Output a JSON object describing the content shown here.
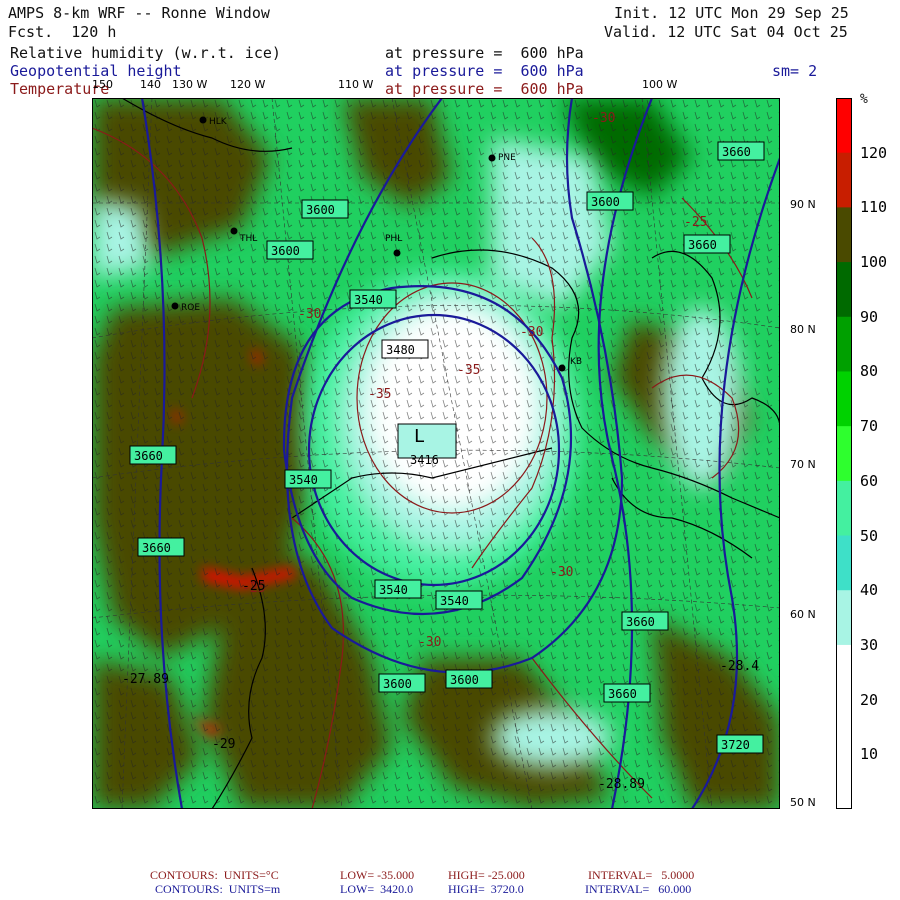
{
  "header": {
    "title": "AMPS 8-km WRF -- Ronne Window",
    "fcst": "Fcst.  120 h",
    "init": "Init. 12 UTC Mon 29 Sep 25",
    "valid": "Valid. 12 UTC Sat 04 Oct 25",
    "sm": "sm= 2"
  },
  "fields": [
    {
      "name": "Relative humidity (w.r.t. ice)",
      "pressure": "at pressure =  600 hPa",
      "color": "#111111"
    },
    {
      "name": "Geopotential height",
      "pressure": "at pressure =  600 hPa",
      "color": "#1a1a99"
    },
    {
      "name": "Temperature",
      "pressure": "at pressure =  600 hPa",
      "color": "#8b1a1a"
    }
  ],
  "longitude_labels": [
    "150",
    "140",
    "130 W",
    "120 W",
    "110 W",
    "100 W"
  ],
  "latitude_labels": [
    "90 N",
    "80 N",
    "70 N",
    "60 N",
    "50 N"
  ],
  "colorbar": {
    "unit": "%",
    "labels": [
      "120",
      "110",
      "100",
      "90",
      "80",
      "70",
      "60",
      "50",
      "40",
      "30",
      "20",
      "10"
    ],
    "colors": [
      "#ff0000",
      "#c81e00",
      "#4a4a00",
      "#006a00",
      "#00a000",
      "#00d200",
      "#2eff2e",
      "#44f0a0",
      "#3ee0c8",
      "#a8f4e4",
      "#ffffff",
      "#ffffff",
      "#ffffff"
    ]
  },
  "stations": [
    {
      "code": "PNE"
    },
    {
      "code": "PHL"
    },
    {
      "code": "THL"
    },
    {
      "code": "ROE"
    },
    {
      "code": "HLK"
    },
    {
      "code": "KB"
    }
  ],
  "height_contour_labels": [
    "3600",
    "3600",
    "3540",
    "3480",
    "3660",
    "3540",
    "3660",
    "3540",
    "3540",
    "3600",
    "3600",
    "3660",
    "3660",
    "3660",
    "3660",
    "3720",
    "3600"
  ],
  "temperature_labels": [
    "-30",
    "-30",
    "-35",
    "-35",
    "-30",
    "-25",
    "-30",
    "-30",
    "-25"
  ],
  "low_center": {
    "letter": "L",
    "value": "3416"
  },
  "extreme_labels": [
    "-28.4",
    "-28.89",
    "-27.89",
    "-25",
    "-29"
  ],
  "footer": {
    "temp": {
      "label": "CONTOURS:  UNITS=°C",
      "low": "LOW= -35.000",
      "high": "HIGH= -25.000",
      "interval": "INTERVAL=   5.0000"
    },
    "height": {
      "label": "CONTOURS:  UNITS=m",
      "low": "LOW=  3420.0",
      "high": "HIGH=  3720.0",
      "interval": "INTERVAL=   60.000"
    }
  }
}
